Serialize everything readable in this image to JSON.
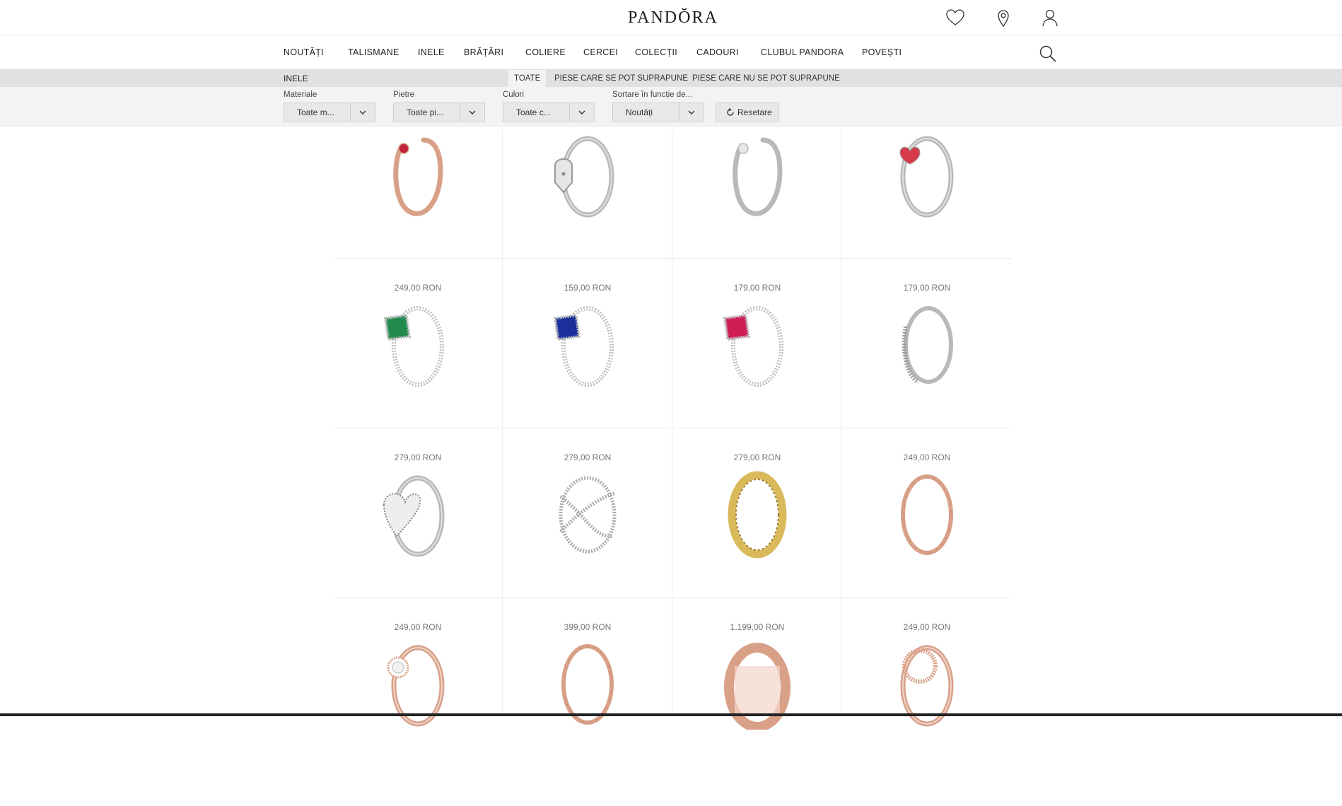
{
  "header": {
    "logo": "PANDŎRA",
    "icons": [
      "heart-icon",
      "location-pin-icon",
      "user-icon"
    ]
  },
  "nav": {
    "items": [
      "NOUTĂȚI",
      "TALISMANE",
      "INELE",
      "BRĂȚĂRI",
      "COLIERE",
      "CERCEI",
      "COLECȚII",
      "CADOURI",
      "CLUBUL PANDORA",
      "POVEȘTI"
    ],
    "search_icon": "search-icon"
  },
  "category": {
    "title": "INELE",
    "tabs": [
      "TOATE",
      "PIESE CARE SE POT SUPRAPUNE",
      "PIESE CARE NU SE POT SUPRAPUNE"
    ],
    "active_tab": "TOATE"
  },
  "filters": {
    "materials": {
      "label": "Materiale",
      "value": "Toate m..."
    },
    "stones": {
      "label": "Pietre",
      "value": "Toate pi..."
    },
    "colors": {
      "label": "Culori",
      "value": "Toate c..."
    },
    "sort": {
      "label": "Sortare în funcție de...",
      "value": "Noutăți"
    },
    "reset_label": "Resetare"
  },
  "products": [
    {
      "price": "249,00 RON",
      "metal": "#d9a088",
      "stone": "#c0253a",
      "style": "open"
    },
    {
      "price": "159,00 RON",
      "metal": "#b9b9b9",
      "stone": "",
      "style": "padlock"
    },
    {
      "price": "179,00 RON",
      "metal": "#b9b9b9",
      "stone": "",
      "style": "open"
    },
    {
      "price": "179,00 RON",
      "metal": "#b9b9b9",
      "stone": "#d63a4a",
      "style": "heart"
    },
    {
      "price": "279,00 RON",
      "metal": "#b9b9b9",
      "stone": "#1f8a4c",
      "style": "square"
    },
    {
      "price": "279,00 RON",
      "metal": "#b9b9b9",
      "stone": "#1c2f9a",
      "style": "square"
    },
    {
      "price": "279,00 RON",
      "metal": "#b9b9b9",
      "stone": "#d01c55",
      "style": "square"
    },
    {
      "price": "249,00 RON",
      "metal": "#b9b9b9",
      "stone": "",
      "style": "wrap"
    },
    {
      "price": "249,00 RON",
      "metal": "#b9b9b9",
      "stone": "",
      "style": "heartpave"
    },
    {
      "price": "399,00 RON",
      "metal": "#b9b9b9",
      "stone": "",
      "style": "crossover"
    },
    {
      "price": "1.199,00 RON",
      "metal": "#d9b95a",
      "stone": "",
      "style": "band"
    },
    {
      "price": "249,00 RON",
      "metal": "#d9a088",
      "stone": "",
      "style": "band-thin"
    },
    {
      "price": "",
      "metal": "#d9a088",
      "stone": "#f2f2f2",
      "style": "halo"
    },
    {
      "price": "",
      "metal": "#d9a088",
      "stone": "",
      "style": "band-thin"
    },
    {
      "price": "",
      "metal": "#d9a088",
      "stone": "#f4d4cc",
      "style": "wide"
    },
    {
      "price": "",
      "metal": "#d9a088",
      "stone": "",
      "style": "circle-top"
    }
  ]
}
